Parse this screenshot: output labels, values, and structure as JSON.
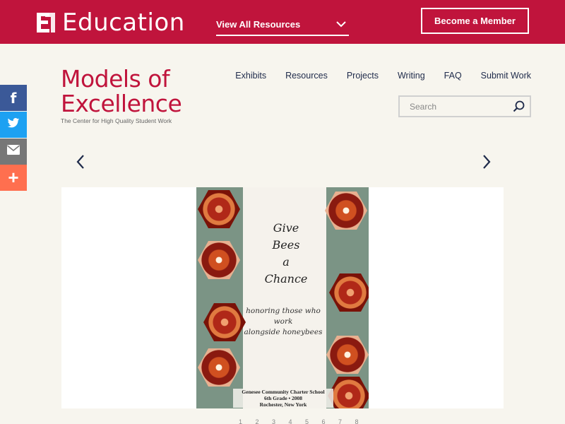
{
  "header": {
    "brand": "Education",
    "resources_dropdown": "View All Resources",
    "member_button": "Become a Member"
  },
  "logo": {
    "line1": "Models of",
    "line2": "Excellence",
    "tagline": "The Center for High Quality Student Work"
  },
  "nav": [
    "Exhibits",
    "Resources",
    "Projects",
    "Writing",
    "FAQ",
    "Submit Work"
  ],
  "search": {
    "placeholder": "Search"
  },
  "share": {
    "facebook": "f",
    "plus": "+"
  },
  "cover": {
    "title_lines": [
      "Give",
      "Bees",
      "a",
      "Chance"
    ],
    "subtitle_lines": [
      "honoring those who work",
      "alongside honeybees"
    ],
    "footer_lines": [
      "Genesee Community Charter School",
      "6th Grade • 2008",
      "Rochester, New York"
    ]
  },
  "pagination": "1 2 3 4 5 6 7 8",
  "colors": {
    "brand": "#c0143c",
    "nav": "#1e2a4a",
    "facebook": "#3b5998",
    "twitter": "#1da1f2",
    "email": "#777777",
    "plus": "#ff6f4f"
  }
}
